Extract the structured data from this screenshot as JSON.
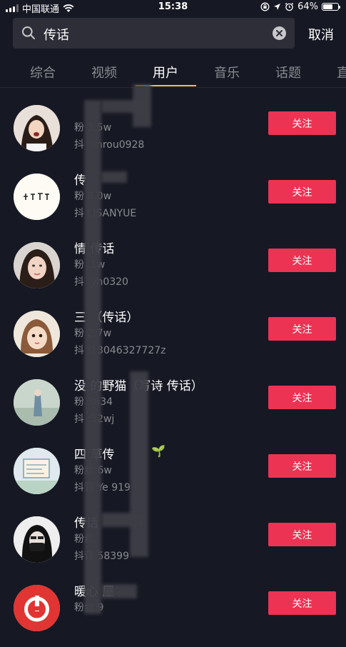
{
  "status_bar": {
    "carrier": "中国联通",
    "time": "15:38",
    "battery_text": "64%",
    "battery_level": 0.64
  },
  "search": {
    "query": "传话",
    "cancel_label": "取消"
  },
  "tabs": [
    {
      "label": "综合",
      "active": false
    },
    {
      "label": "视频",
      "active": false
    },
    {
      "label": "用户",
      "active": true
    },
    {
      "label": "音乐",
      "active": false
    },
    {
      "label": "话题",
      "active": false
    },
    {
      "label": "直",
      "active": false
    }
  ],
  "follow_label": "关注",
  "users": [
    {
      "name": "",
      "fans": "粉  3.5w",
      "douyin_id": "抖        :linrou0928"
    },
    {
      "name": "传",
      "fans": "粉  8.0w",
      "douyin_id": "抖        LISANYUE"
    },
    {
      "name": "情  传话",
      "fans": "粉  .1w",
      "douyin_id": "抖        :yh0320"
    },
    {
      "name": "三    （传话）",
      "fans": "粉  2.7w",
      "douyin_id": "抖        :13046327727z"
    },
    {
      "name": "没    的野猫（写诗 传话）",
      "fans": "粉  3634",
      "douyin_id": "抖        :52wj"
    },
    {
      "name": "四    草传",
      "fans": "粉丝  6w",
      "douyin_id": "抖音    Ye     919"
    },
    {
      "name": "传话",
      "fans": "粉丝",
      "douyin_id": "抖音          58399"
    },
    {
      "name": "暖心      屋",
      "fans": "粉丝    9",
      "douyin_id": ""
    }
  ]
}
